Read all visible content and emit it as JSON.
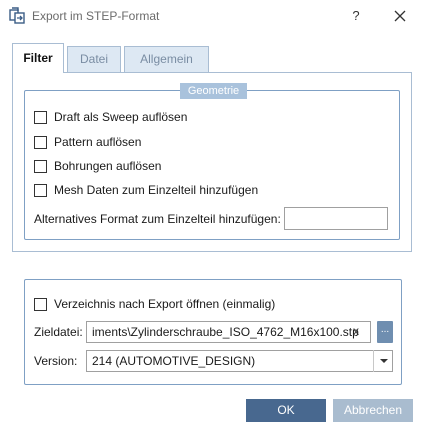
{
  "window": {
    "title": "Export im STEP-Format",
    "help_label": "?"
  },
  "tabs": [
    {
      "label": "Filter",
      "active": true
    },
    {
      "label": "Datei",
      "active": false
    },
    {
      "label": "Allgemein",
      "active": false
    }
  ],
  "geometry_group": {
    "legend": "Geometrie",
    "options": [
      {
        "label": "Draft als Sweep auflösen",
        "checked": false
      },
      {
        "label": "Pattern auflösen",
        "checked": false
      },
      {
        "label": "Bohrungen auflösen",
        "checked": false
      },
      {
        "label": "Mesh Daten zum Einzelteil hinzufügen",
        "checked": false
      }
    ],
    "alt_format_label": "Alternatives Format zum Einzelteil hinzufügen:",
    "alt_format_value": ""
  },
  "export_group": {
    "open_dir_label": "Verzeichnis nach Export öffnen (einmalig)",
    "open_dir_checked": false,
    "target_label": "Zieldatei:",
    "target_value": "iments\\Zylinderschraube_ISO_4762_M16x100.stp",
    "clear_label": "x",
    "browse_label": "...",
    "version_label": "Version:",
    "version_value": "214 (AUTOMOTIVE_DESIGN)"
  },
  "buttons": {
    "ok": "OK",
    "cancel": "Abbrechen"
  },
  "colors": {
    "accent": "#48688f",
    "border": "#a9bdd3",
    "legend_bg": "#a9c2dc",
    "disabled_button": "#a9bccf"
  }
}
